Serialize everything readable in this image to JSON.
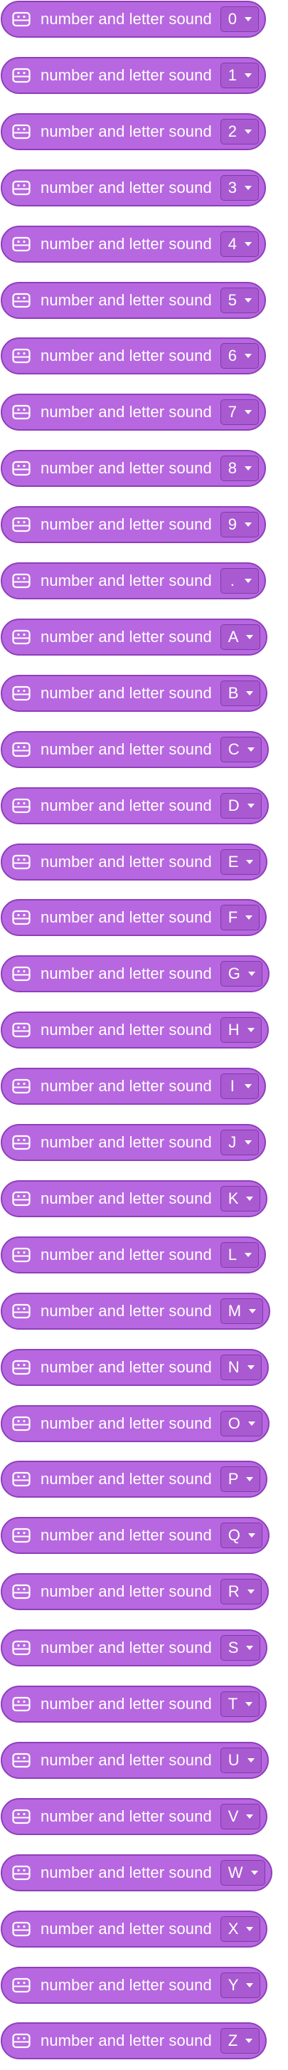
{
  "colors": {
    "block_fill": "#b768e0",
    "block_border": "#8e3fba",
    "dropdown_fill": "#a95ad1",
    "dropdown_border": "#8239a9",
    "text": "#ffffff"
  },
  "blocks": [
    {
      "label": "number and letter sound",
      "value": "0",
      "icon": "robot-icon"
    },
    {
      "label": "number and letter sound",
      "value": "1",
      "icon": "robot-icon"
    },
    {
      "label": "number and letter sound",
      "value": "2",
      "icon": "robot-icon"
    },
    {
      "label": "number and letter sound",
      "value": "3",
      "icon": "robot-icon"
    },
    {
      "label": "number and letter sound",
      "value": "4",
      "icon": "robot-icon"
    },
    {
      "label": "number and letter sound",
      "value": "5",
      "icon": "robot-icon"
    },
    {
      "label": "number and letter sound",
      "value": "6",
      "icon": "robot-icon"
    },
    {
      "label": "number and letter sound",
      "value": "7",
      "icon": "robot-icon"
    },
    {
      "label": "number and letter sound",
      "value": "8",
      "icon": "robot-icon"
    },
    {
      "label": "number and letter sound",
      "value": "9",
      "icon": "robot-icon"
    },
    {
      "label": "number and letter sound",
      "value": ".",
      "icon": "robot-icon"
    },
    {
      "label": "number and letter sound",
      "value": "A",
      "icon": "robot-icon"
    },
    {
      "label": "number and letter sound",
      "value": "B",
      "icon": "robot-icon"
    },
    {
      "label": "number and letter sound",
      "value": "C",
      "icon": "robot-icon"
    },
    {
      "label": "number and letter sound",
      "value": "D",
      "icon": "robot-icon"
    },
    {
      "label": "number and letter sound",
      "value": "E",
      "icon": "robot-icon"
    },
    {
      "label": "number and letter sound",
      "value": "F",
      "icon": "robot-icon"
    },
    {
      "label": "number and letter sound",
      "value": "G",
      "icon": "robot-icon"
    },
    {
      "label": "number and letter sound",
      "value": "H",
      "icon": "robot-icon"
    },
    {
      "label": "number and letter sound",
      "value": "I",
      "icon": "robot-icon"
    },
    {
      "label": "number and letter sound",
      "value": "J",
      "icon": "robot-icon"
    },
    {
      "label": "number and letter sound",
      "value": "K",
      "icon": "robot-icon"
    },
    {
      "label": "number and letter sound",
      "value": "L",
      "icon": "robot-icon"
    },
    {
      "label": "number and letter sound",
      "value": "M",
      "icon": "robot-icon"
    },
    {
      "label": "number and letter sound",
      "value": "N",
      "icon": "robot-icon"
    },
    {
      "label": "number and letter sound",
      "value": "O",
      "icon": "robot-icon"
    },
    {
      "label": "number and letter sound",
      "value": "P",
      "icon": "robot-icon"
    },
    {
      "label": "number and letter sound",
      "value": "Q",
      "icon": "robot-icon"
    },
    {
      "label": "number and letter sound",
      "value": "R",
      "icon": "robot-icon"
    },
    {
      "label": "number and letter sound",
      "value": "S",
      "icon": "robot-icon"
    },
    {
      "label": "number and letter sound",
      "value": "T",
      "icon": "robot-icon"
    },
    {
      "label": "number and letter sound",
      "value": "U",
      "icon": "robot-icon"
    },
    {
      "label": "number and letter sound",
      "value": "V",
      "icon": "robot-icon"
    },
    {
      "label": "number and letter sound",
      "value": "W",
      "icon": "robot-icon"
    },
    {
      "label": "number and letter sound",
      "value": "X",
      "icon": "robot-icon"
    },
    {
      "label": "number and letter sound",
      "value": "Y",
      "icon": "robot-icon"
    },
    {
      "label": "number and letter sound",
      "value": "Z",
      "icon": "robot-icon"
    }
  ]
}
